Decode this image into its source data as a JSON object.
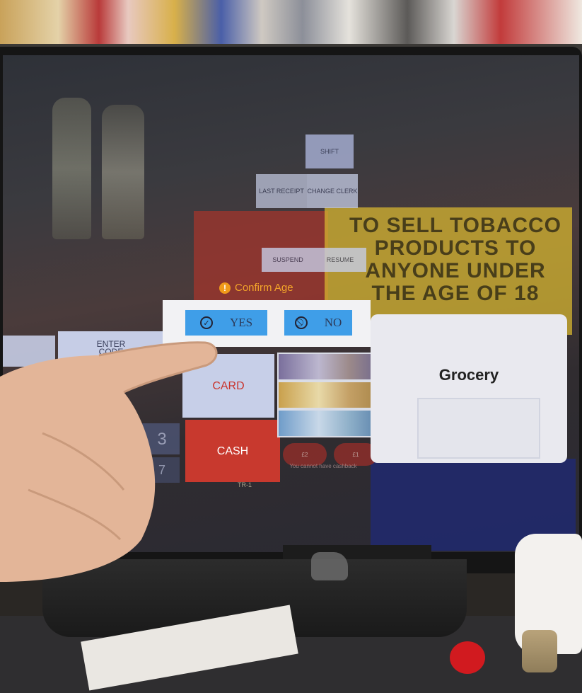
{
  "pos": {
    "shift_label": "SHIFT",
    "last_receipt_label": "LAST RECEIPT",
    "change_clerk_label": "CHANGE CLERK",
    "suspend_label": "SUSPEND",
    "resume_label": "RESUME",
    "enter_code_label": "ENTER CODE",
    "key_3_label": "3",
    "key_7_label": "7",
    "card_label": "CARD",
    "cash_label": "CASH",
    "coin_2_label": "£2",
    "coin_1_label": "£1",
    "grocery_label": "Grocery",
    "cashback_message": "You cannot have cashback",
    "tr_label": "TR-1"
  },
  "confirm_age": {
    "title": "Confirm Age",
    "title_icon": "!",
    "yes_label": "YES",
    "no_label": "NO",
    "yes_icon": "check-circle-icon",
    "no_icon": "ban-icon"
  },
  "reflection": {
    "lines": [
      "TO SELL TOBACCO",
      "PRODUCTS TO",
      "ANYONE UNDER",
      "THE AGE OF 18"
    ]
  },
  "colors": {
    "accent_blue": "#3f9ee8",
    "confirm_orange": "#f4a52a",
    "cash_red": "#c8392e"
  }
}
